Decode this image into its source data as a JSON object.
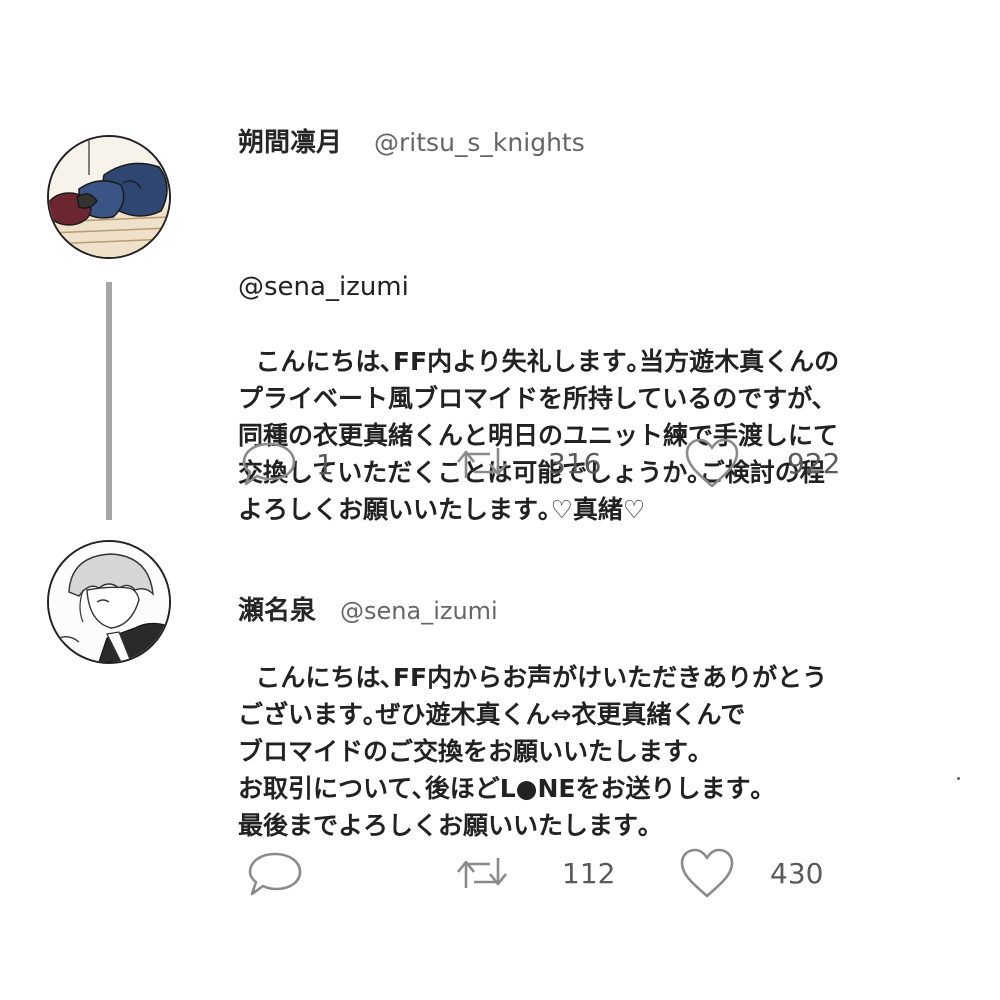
{
  "tweets": [
    {
      "display_name": "朔間凛月",
      "handle": "@ritsu_s_knights",
      "reply_to": "@sena_izumi",
      "body": "こんにちは､FF内より失礼します｡当方遊木真くんの\nプライベート風ブロマイドを所持しているのですが､\n同種の衣更真緒くんと明日のユニット練で手渡しにて\n交換していただくことは可能でしょうか｡ご検討の程\nよろしくお願いいたします｡♡真緒♡",
      "reply_count": "1",
      "retweet_count": "316",
      "like_count": "922"
    },
    {
      "display_name": "瀬名泉",
      "handle": "@sena_izumi",
      "body": "こんにちは､FF内からお声がけいただきありがとう\nございます｡ぜひ遊木真くん⇔衣更真緒くんで\nブロマイドのご交換をお願いいたします｡\nお取引について､後ほどL●NEをお送りします｡\n最後までよろしくお願いいたします｡",
      "reply_count": "",
      "retweet_count": "112",
      "like_count": "430"
    }
  ],
  "icons": {
    "reply": "speech-bubble-icon",
    "retweet": "retweet-arrows-icon",
    "like": "heart-outline-icon"
  },
  "colors": {
    "text": "#222222",
    "muted": "#5a5a5a",
    "icon_stroke": "#8a8a8a",
    "thread_line": "#a6a6a6"
  }
}
